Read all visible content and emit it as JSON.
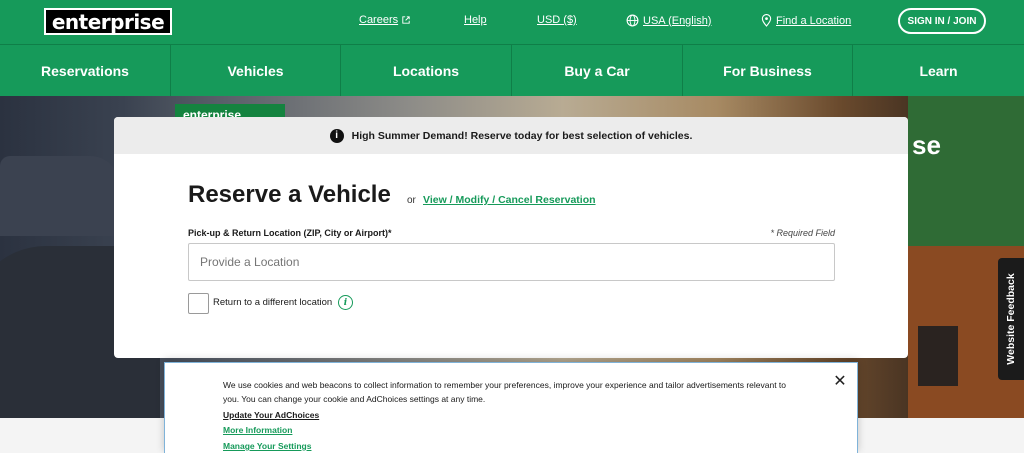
{
  "header": {
    "logo_text": "enterprise",
    "links": {
      "careers": "Careers",
      "help": "Help",
      "currency": "USD ($)",
      "region": "USA (English)",
      "find_location": "Find a Location"
    },
    "sign_in": "SIGN IN / JOIN"
  },
  "nav": {
    "items": [
      "Reservations",
      "Vehicles",
      "Locations",
      "Buy a Car",
      "For Business",
      "Learn"
    ]
  },
  "hero": {
    "sign_text": "enterprise",
    "wall_text": "se"
  },
  "feedback": {
    "label": "Website Feedback"
  },
  "reserve": {
    "banner": "High Summer Demand! Reserve today for best selection of vehicles.",
    "title": "Reserve a Vehicle",
    "or_text": "or",
    "modify_link": "View / Modify / Cancel Reservation",
    "location_label": "Pick-up & Return Location (ZIP, City or Airport)*",
    "required_note": "* Required Field",
    "location_placeholder": "Provide a Location",
    "return_different": "Return to a different location"
  },
  "cookie": {
    "message": "We use cookies and web beacons to collect information to remember your preferences, improve your experience and tailor advertisements relevant to you. You can change your cookie and AdChoices settings at any time.",
    "link_adchoices": "Update Your AdChoices",
    "link_more_info": "More Information",
    "link_settings": "Manage Your Settings",
    "close_symbol": "✕"
  },
  "colors": {
    "brand_green": "#169a5a",
    "dark": "#1a1a1a"
  }
}
